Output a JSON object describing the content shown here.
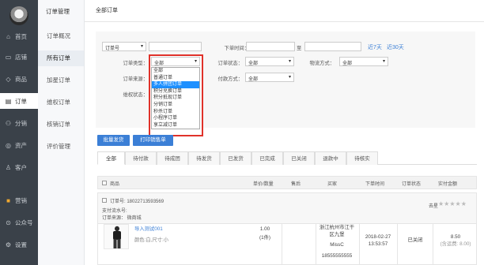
{
  "sidebar": {
    "items": [
      {
        "icon": "home-icon",
        "glyph": "⌂",
        "label": "首页"
      },
      {
        "icon": "store-icon",
        "glyph": "▭",
        "label": "店铺"
      },
      {
        "icon": "tag-icon",
        "glyph": "◇",
        "label": "商品"
      },
      {
        "icon": "order-icon",
        "glyph": "▤",
        "label": "订单"
      },
      {
        "icon": "distribution-icon",
        "glyph": "⚇",
        "label": "分销"
      },
      {
        "icon": "assets-icon",
        "glyph": "◎",
        "label": "资产"
      },
      {
        "icon": "customer-icon",
        "glyph": "♙",
        "label": "客户"
      },
      {
        "icon": "marketing-icon",
        "glyph": "■",
        "label": "营销"
      },
      {
        "icon": "wechat-icon",
        "glyph": "⊙",
        "label": "公众号"
      },
      {
        "icon": "settings-icon",
        "glyph": "⚙",
        "label": "设置"
      }
    ]
  },
  "subnav": {
    "title": "订单管理",
    "items": [
      "订单概况",
      "所有订单",
      "加星订单",
      "维权订单",
      "核销订单",
      "评价管理"
    ]
  },
  "tabbar": {
    "all_orders": "全部订单"
  },
  "filters": {
    "order_no_select": "订单号",
    "order_type_label": "订单类型：",
    "order_type_value": "全部",
    "order_source_label": "订单来源：",
    "rights_label": "维权状态：",
    "order_time_label": "下单时间：",
    "to_label": "至",
    "last7": "近7天",
    "last30": "近30天",
    "order_status_label": "订单状态：",
    "order_status_value": "全部",
    "logistics_label": "物流方式：",
    "logistics_value": "全部",
    "payment_label": "付款方式：",
    "payment_value": "全部",
    "dropdown_options": [
      "全部",
      "普通订单",
      "多人拼团订单",
      "积分兑换订单",
      "积分抵现订单",
      "分销订单",
      "秒杀订单",
      "小程序订单",
      "享立减订单"
    ],
    "highlighted_index": 2
  },
  "actions": {
    "batch_ship": "批量发货",
    "print_sales": "打印销售单"
  },
  "order_tabs": [
    "全部",
    "待付款",
    "待成团",
    "待发货",
    "已发货",
    "已完成",
    "已关闭",
    "退款中",
    "待核实"
  ],
  "table_headers": {
    "product": "商品",
    "price_qty": "单价/数量",
    "after_sale": "售后",
    "buyer": "买家",
    "order_time": "下单时间",
    "order_status": "订单状态",
    "paid": "实付金额"
  },
  "order": {
    "order_no": "订单号: 18022713593569",
    "pay_serial": "支付流水号:",
    "source": "订单来源： 微商城",
    "star_label": "去星",
    "product_name": "导入测试001",
    "product_spec": "颜色:白,尺寸:小",
    "unit_price": "1.00",
    "qty": "(1件)",
    "buyer_addr1": "浙江杭州市江干",
    "buyer_addr2": "区九堡",
    "buyer_name": "MissC",
    "buyer_phone": "18555555555",
    "date": "2018-02-27",
    "time": "13:53:57",
    "status": "已关闭",
    "amount": "8.50",
    "shipping": "(含运费: 8.00)"
  },
  "colors": {
    "accent": "#3b7fd6",
    "sidebar": "#3a4149",
    "highlight_border": "#e0322a",
    "option_highlight": "#1e90ff"
  }
}
